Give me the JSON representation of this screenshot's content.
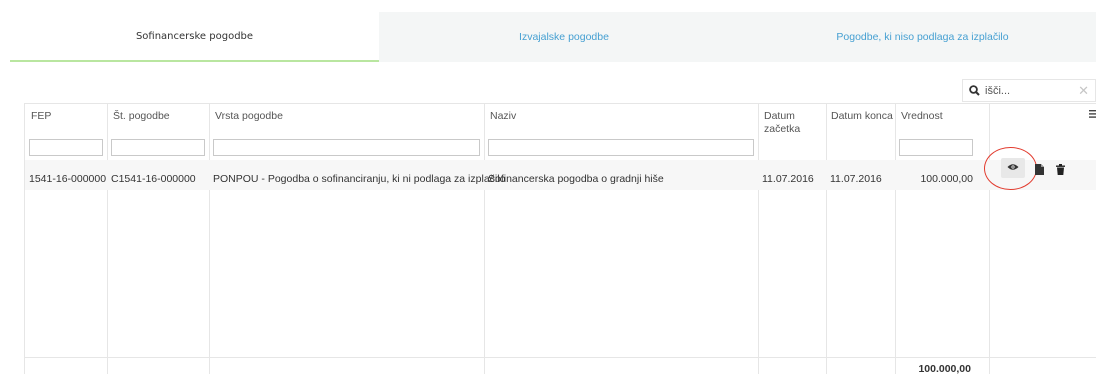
{
  "tabs": [
    {
      "label": "Sofinancerske pogodbe",
      "active": true
    },
    {
      "label": "Izvajalske pogodbe",
      "active": false
    },
    {
      "label": "Pogodbe, ki niso podlaga za izplačilo",
      "active": false
    }
  ],
  "search": {
    "placeholder": "išči..."
  },
  "table": {
    "columns": [
      "FEP",
      "Št. pogodbe",
      "Vrsta pogodbe",
      "Naziv",
      "Datum začetka",
      "Datum konca",
      "Vrednost"
    ],
    "rows": [
      {
        "fep": "1541-16-000000",
        "st_pogodbe": "C1541-16-000000",
        "vrsta": "PONPOU - Pogodba o sofinanciranju, ki ni podlaga za izplačilo",
        "naziv": "Sofinancerska pogodba o gradnji hiše",
        "datum_zacetka": "11.07.2016",
        "datum_konca": "11.07.2016",
        "vrednost": "100.000,00"
      }
    ],
    "total": "100.000,00"
  },
  "colors": {
    "accent_green": "#b9e6a0",
    "link_blue": "#46a0d2",
    "highlight_red": "#e23b2e"
  },
  "icons": [
    "search-icon",
    "clear-icon",
    "column-menu-icon",
    "eye-icon",
    "document-icon",
    "trash-icon"
  ]
}
